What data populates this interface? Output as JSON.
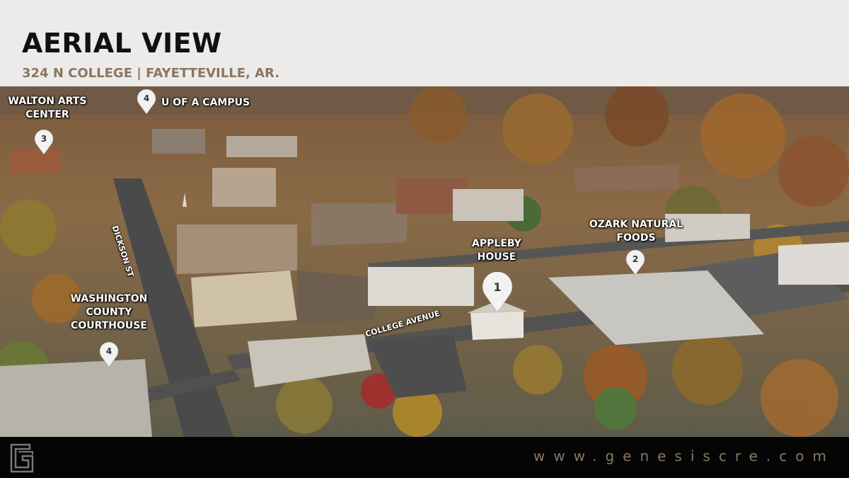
{
  "header": {
    "title": "AERIAL VIEW",
    "subtitle": "324 N COLLEGE | FAYETTEVILLE, AR."
  },
  "map": {
    "labels": {
      "walton": "WALTON ARTS CENTER",
      "uofa": "U OF A CAMPUS",
      "appleby": "APPLEBY HOUSE",
      "ozark": "OZARK NATURAL FOODS",
      "courthouse": "WASHINGTON COUNTY COURTHOUSE"
    },
    "streets": {
      "dickson": "DICKSON ST",
      "college": "COLLEGE AVENUE"
    },
    "pins": {
      "appleby": "1",
      "ozark": "2",
      "walton": "3",
      "uofa": "4",
      "courthouse": "4"
    }
  },
  "footer": {
    "url": "www.genesiscre.com",
    "logo_icon": "genesis-logo-icon"
  },
  "colors": {
    "header_bg": "#ecebe9",
    "accent": "#8a7660",
    "footer_bg": "#050505"
  }
}
